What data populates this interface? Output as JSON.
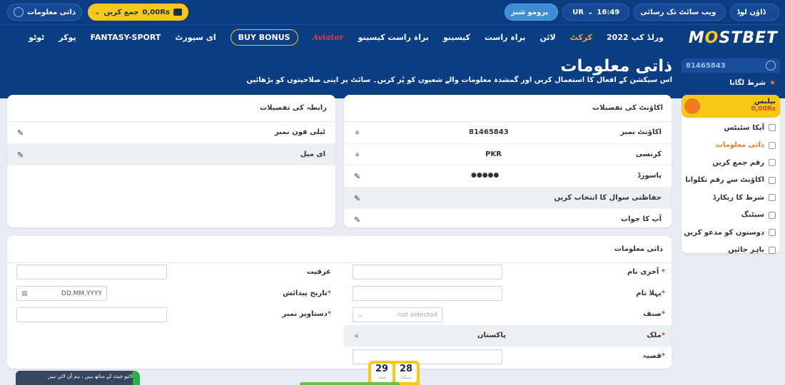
{
  "topbar": {
    "account_label": "ذاتی معلومات",
    "balance_label": "0,00Rs",
    "deposit_label": "جمع کریں",
    "promos_label": "پرومو شنز",
    "time": "16:49",
    "lang": "UR",
    "web_tech_label": "ویب سائٹ تک رسائی",
    "download_label": "ڈاؤن لوڈ"
  },
  "logo": {
    "pre": "M",
    "star": "O",
    "post": "STBET"
  },
  "nav": [
    "ورلڈ کپ 2022",
    "کرکٹ",
    "لائن",
    "براہ راست",
    "کیسینو",
    "براہ راست کیسینو",
    "Aviator",
    "BUY BONUS",
    "ای سپورٹ",
    "FANTASY-SPORT",
    "پوکر",
    "ٹوٹو"
  ],
  "header": {
    "title": "ذاتی معلومات",
    "subtitle": "اس سیکشن کے افعال کا استعمال کریں اور گمشدہ معلومات والے شعبوں کو پُر کریں۔ سائٹ پر اپنی صلاحیتوں کو بڑھائیں"
  },
  "sidebar": {
    "account_id": "81465843",
    "bet_label": "شرط لگانا",
    "balance_title": "بیلنس",
    "balance_value": "0,00Rs",
    "items": [
      {
        "label": "آپکا سٹیٹس"
      },
      {
        "label": "ذاتی معلومات"
      },
      {
        "label": "رقم جمع کریں"
      },
      {
        "label": "اکاؤنٹ سے رقم نکلوانا"
      },
      {
        "label": "شرط کا ریکارڈ"
      },
      {
        "label": "سیٹنگ"
      },
      {
        "label": "دوستوں کو مدعو کریں"
      },
      {
        "label": "باہر جائیں"
      }
    ]
  },
  "account_card": {
    "title": "اکاؤنٹ کی تفصیلات",
    "rows": [
      {
        "label": "اکاؤنٹ نمبر",
        "value": "81465843"
      },
      {
        "label": "کرنسی",
        "value": "PKR"
      },
      {
        "label": "پاسورڈ",
        "value": "●●●●●"
      },
      {
        "label": "حفاظتی سوال کا انتخاب کریں",
        "value": ""
      },
      {
        "label": "آپ کا جواب",
        "value": ""
      }
    ]
  },
  "contact_card": {
    "title": "رابطہ کی تفصیلات",
    "rows": [
      {
        "label": "ٹیلی فون نمبر"
      },
      {
        "label": "ای میل"
      }
    ]
  },
  "personal_card": {
    "title": "ذاتی معلومات",
    "last_name": "آخری نام",
    "first_name": "پہلا نام",
    "gender": "صنف",
    "gender_placeholder": "not selected",
    "country": "ملک",
    "country_value": "پاکستان",
    "city": "قصبہ",
    "nickname": "عرفیت",
    "dob": "تاریخ پیدائش",
    "dob_placeholder": "DD.MM.YYYY",
    "doc": "دستاویز نمبر"
  },
  "timer": {
    "d1": "29",
    "s1": "منٹ",
    "d2": "28",
    "s2": "سیکنڈ"
  },
  "chat": {
    "text": "لائیو چیٹ کے ساتھ ہیں ، ہم آن لائن ہیں"
  }
}
